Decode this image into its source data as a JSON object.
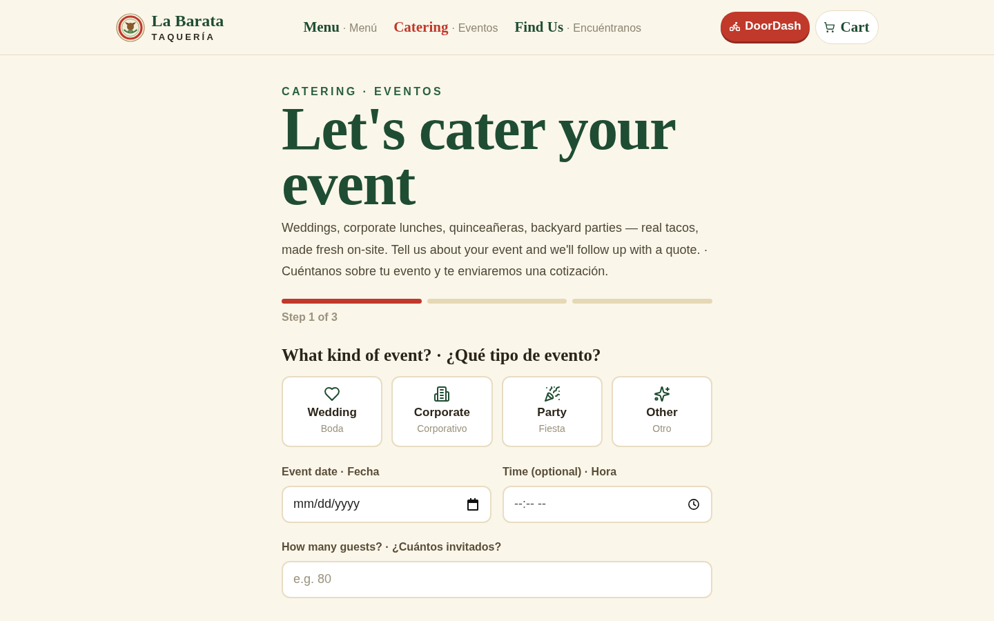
{
  "header": {
    "brand": {
      "name": "La Barata",
      "tagline": "TAQUERÍA"
    },
    "nav": [
      {
        "label": "Menu",
        "sublabel": "· Menú",
        "selected": false
      },
      {
        "label": "Catering",
        "sublabel": "· Eventos",
        "selected": true
      },
      {
        "label": "Find Us",
        "sublabel": "· Encuéntranos",
        "selected": false
      }
    ],
    "doordash_button": {
      "label": "DoorDash"
    },
    "cart_button": {
      "label": "Cart"
    }
  },
  "intro": {
    "eyebrow": "CATERING · EVENTOS",
    "title": "Let's cater your event",
    "description": "Weddings, corporate lunches, quinceañeras, backyard parties — real tacos, made fresh on-site. Tell us about your event and we'll follow up with a quote. · Cuéntanos sobre tu evento y te enviaremos una cotización."
  },
  "progress": {
    "segments": [
      {
        "complete": true
      },
      {
        "complete": false
      },
      {
        "complete": false
      }
    ],
    "label": "Step 1 of 3"
  },
  "question": "What kind of event? · ¿Qué tipo de evento?",
  "event_types": [
    {
      "label": "Wedding",
      "sublabel": "Boda",
      "selected": false
    },
    {
      "label": "Corporate",
      "sublabel": "Corporativo",
      "selected": false
    },
    {
      "label": "Party",
      "sublabel": "Fiesta",
      "selected": false
    },
    {
      "label": "Other",
      "sublabel": "Otro",
      "selected": false
    }
  ],
  "form_rows": [
    {
      "fields": [
        {
          "kind": "date",
          "label": "Event date · Fecha",
          "placeholder": "mm/dd/yyyy"
        },
        {
          "kind": "time",
          "label": "Time (optional) · Hora",
          "placeholder": "--:-- --"
        }
      ]
    },
    {
      "fields": [
        {
          "kind": "number",
          "label": "How many guests? · ¿Cuántos invitados?",
          "placeholder": "e.g. 80"
        }
      ]
    }
  ]
}
